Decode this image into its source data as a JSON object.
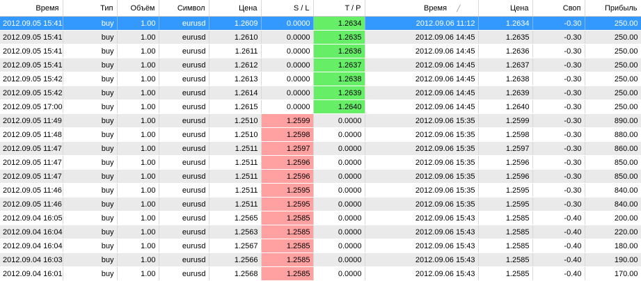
{
  "columns": [
    "Время",
    "Тип",
    "Объём",
    "Символ",
    "Цена",
    "S / L",
    "T / P",
    "Время",
    "Цена",
    "Своп",
    "Прибыль"
  ],
  "colors": {
    "selected": "#3399ff",
    "tp_highlight": "#66ee66",
    "sl_highlight": "#ffa1a1"
  },
  "rows": [
    {
      "open_time": "2012.09.05 15:41",
      "type": "buy",
      "volume": "1.00",
      "symbol": "eurusd",
      "open_price": "1.2609",
      "sl": "0.0000",
      "tp": "1.2634",
      "close_time": "2012.09.06 11:12",
      "close_price": "1.2634",
      "swap": "-0.30",
      "profit": "250.00",
      "highlight": "tp",
      "selected": true
    },
    {
      "open_time": "2012.09.05 15:41",
      "type": "buy",
      "volume": "1.00",
      "symbol": "eurusd",
      "open_price": "1.2610",
      "sl": "0.0000",
      "tp": "1.2635",
      "close_time": "2012.09.06 14:45",
      "close_price": "1.2635",
      "swap": "-0.30",
      "profit": "250.00",
      "highlight": "tp"
    },
    {
      "open_time": "2012.09.05 15:41",
      "type": "buy",
      "volume": "1.00",
      "symbol": "eurusd",
      "open_price": "1.2611",
      "sl": "0.0000",
      "tp": "1.2636",
      "close_time": "2012.09.06 14:45",
      "close_price": "1.2636",
      "swap": "-0.30",
      "profit": "250.00",
      "highlight": "tp"
    },
    {
      "open_time": "2012.09.05 15:41",
      "type": "buy",
      "volume": "1.00",
      "symbol": "eurusd",
      "open_price": "1.2612",
      "sl": "0.0000",
      "tp": "1.2637",
      "close_time": "2012.09.06 14:45",
      "close_price": "1.2637",
      "swap": "-0.30",
      "profit": "250.00",
      "highlight": "tp"
    },
    {
      "open_time": "2012.09.05 15:42",
      "type": "buy",
      "volume": "1.00",
      "symbol": "eurusd",
      "open_price": "1.2613",
      "sl": "0.0000",
      "tp": "1.2638",
      "close_time": "2012.09.06 14:45",
      "close_price": "1.2638",
      "swap": "-0.30",
      "profit": "250.00",
      "highlight": "tp"
    },
    {
      "open_time": "2012.09.05 15:42",
      "type": "buy",
      "volume": "1.00",
      "symbol": "eurusd",
      "open_price": "1.2614",
      "sl": "0.0000",
      "tp": "1.2639",
      "close_time": "2012.09.06 14:45",
      "close_price": "1.2639",
      "swap": "-0.30",
      "profit": "250.00",
      "highlight": "tp"
    },
    {
      "open_time": "2012.09.05 17:00",
      "type": "buy",
      "volume": "1.00",
      "symbol": "eurusd",
      "open_price": "1.2615",
      "sl": "0.0000",
      "tp": "1.2640",
      "close_time": "2012.09.06 14:45",
      "close_price": "1.2640",
      "swap": "-0.30",
      "profit": "250.00",
      "highlight": "tp"
    },
    {
      "open_time": "2012.09.05 11:49",
      "type": "buy",
      "volume": "1.00",
      "symbol": "eurusd",
      "open_price": "1.2510",
      "sl": "1.2599",
      "tp": "0.0000",
      "close_time": "2012.09.06 15:35",
      "close_price": "1.2599",
      "swap": "-0.30",
      "profit": "890.00",
      "highlight": "sl"
    },
    {
      "open_time": "2012.09.05 11:48",
      "type": "buy",
      "volume": "1.00",
      "symbol": "eurusd",
      "open_price": "1.2510",
      "sl": "1.2598",
      "tp": "0.0000",
      "close_time": "2012.09.06 15:35",
      "close_price": "1.2598",
      "swap": "-0.30",
      "profit": "880.00",
      "highlight": "sl"
    },
    {
      "open_time": "2012.09.05 11:47",
      "type": "buy",
      "volume": "1.00",
      "symbol": "eurusd",
      "open_price": "1.2511",
      "sl": "1.2597",
      "tp": "0.0000",
      "close_time": "2012.09.06 15:35",
      "close_price": "1.2597",
      "swap": "-0.30",
      "profit": "860.00",
      "highlight": "sl"
    },
    {
      "open_time": "2012.09.05 11:47",
      "type": "buy",
      "volume": "1.00",
      "symbol": "eurusd",
      "open_price": "1.2511",
      "sl": "1.2596",
      "tp": "0.0000",
      "close_time": "2012.09.06 15:35",
      "close_price": "1.2596",
      "swap": "-0.30",
      "profit": "850.00",
      "highlight": "sl"
    },
    {
      "open_time": "2012.09.05 11:47",
      "type": "buy",
      "volume": "1.00",
      "symbol": "eurusd",
      "open_price": "1.2511",
      "sl": "1.2596",
      "tp": "0.0000",
      "close_time": "2012.09.06 15:35",
      "close_price": "1.2596",
      "swap": "-0.30",
      "profit": "850.00",
      "highlight": "sl"
    },
    {
      "open_time": "2012.09.05 11:46",
      "type": "buy",
      "volume": "1.00",
      "symbol": "eurusd",
      "open_price": "1.2511",
      "sl": "1.2595",
      "tp": "0.0000",
      "close_time": "2012.09.06 15:35",
      "close_price": "1.2595",
      "swap": "-0.30",
      "profit": "840.00",
      "highlight": "sl"
    },
    {
      "open_time": "2012.09.05 11:46",
      "type": "buy",
      "volume": "1.00",
      "symbol": "eurusd",
      "open_price": "1.2511",
      "sl": "1.2595",
      "tp": "0.0000",
      "close_time": "2012.09.06 15:35",
      "close_price": "1.2595",
      "swap": "-0.30",
      "profit": "840.00",
      "highlight": "sl"
    },
    {
      "open_time": "2012.09.04 16:05",
      "type": "buy",
      "volume": "1.00",
      "symbol": "eurusd",
      "open_price": "1.2565",
      "sl": "1.2585",
      "tp": "0.0000",
      "close_time": "2012.09.06 15:43",
      "close_price": "1.2585",
      "swap": "-0.40",
      "profit": "200.00",
      "highlight": "sl"
    },
    {
      "open_time": "2012.09.04 16:04",
      "type": "buy",
      "volume": "1.00",
      "symbol": "eurusd",
      "open_price": "1.2563",
      "sl": "1.2585",
      "tp": "0.0000",
      "close_time": "2012.09.06 15:43",
      "close_price": "1.2585",
      "swap": "-0.40",
      "profit": "220.00",
      "highlight": "sl"
    },
    {
      "open_time": "2012.09.04 16:04",
      "type": "buy",
      "volume": "1.00",
      "symbol": "eurusd",
      "open_price": "1.2567",
      "sl": "1.2585",
      "tp": "0.0000",
      "close_time": "2012.09.06 15:43",
      "close_price": "1.2585",
      "swap": "-0.40",
      "profit": "180.00",
      "highlight": "sl"
    },
    {
      "open_time": "2012.09.04 16:03",
      "type": "buy",
      "volume": "1.00",
      "symbol": "eurusd",
      "open_price": "1.2566",
      "sl": "1.2585",
      "tp": "0.0000",
      "close_time": "2012.09.06 15:43",
      "close_price": "1.2585",
      "swap": "-0.40",
      "profit": "190.00",
      "highlight": "sl"
    },
    {
      "open_time": "2012.09.04 16:01",
      "type": "buy",
      "volume": "1.00",
      "symbol": "eurusd",
      "open_price": "1.2568",
      "sl": "1.2585",
      "tp": "0.0000",
      "close_time": "2012.09.06 15:43",
      "close_price": "1.2585",
      "swap": "-0.40",
      "profit": "170.00",
      "highlight": "sl"
    }
  ]
}
